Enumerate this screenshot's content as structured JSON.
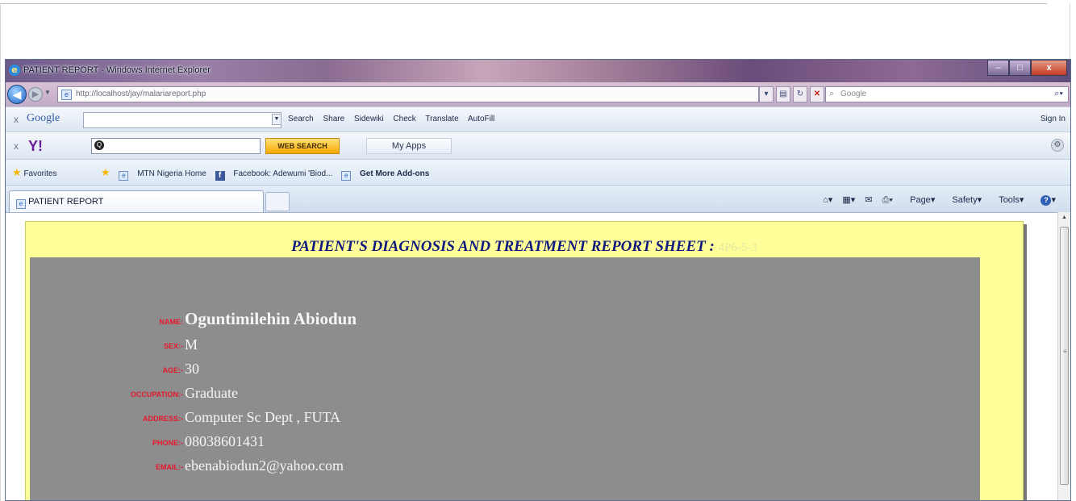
{
  "window": {
    "title": "PATIENT REPORT - Windows Internet Explorer",
    "min_glyph": "–",
    "max_glyph": "□",
    "close_glyph": "x"
  },
  "nav": {
    "url": "http://localhost/jay/malariareport.php",
    "search_placeholder": "Google"
  },
  "google_toolbar": {
    "logo": "Google",
    "items": [
      "Search",
      "Share",
      "Sidewiki",
      "Check",
      "Translate",
      "AutoFill"
    ],
    "sign_in": "Sign In"
  },
  "yahoo_toolbar": {
    "logo": "Y!",
    "web_search": "WEB SEARCH",
    "my_apps": "My Apps"
  },
  "favorites_bar": {
    "favorites_label": "Favorites",
    "links": [
      "MTN Nigeria Home",
      "Facebook: Adewumi 'Biod...",
      "Get More Add-ons"
    ]
  },
  "tabs": {
    "active_tab": "PATIENT REPORT"
  },
  "command_bar": {
    "page": "Page",
    "safety": "Safety",
    "tools": "Tools"
  },
  "report": {
    "title": "PATIENT'S DIAGNOSIS AND TREATMENT REPORT SHEET",
    "separator": ":",
    "report_id": "4P6-5-3",
    "fields": [
      {
        "label": "NAME:",
        "value": "Oguntimilehin Abiodun"
      },
      {
        "label": "SEX:-",
        "value": "M"
      },
      {
        "label": "AGE:-",
        "value": "30"
      },
      {
        "label": "OCCUPATION:-",
        "value": "Graduate"
      },
      {
        "label": "ADDRESS:-",
        "value": "Computer Sc Dept , FUTA"
      },
      {
        "label": "PHONE:-",
        "value": "08038601431"
      },
      {
        "label": "EMAIL:-",
        "value": "ebenabiodun2@yahoo.com"
      }
    ]
  },
  "colors": {
    "report_background": "#ffff99",
    "report_body": "#8d8d8d",
    "title_color": "#10197e",
    "label_color": "#e8172c",
    "value_color": "#f5f5f5"
  }
}
